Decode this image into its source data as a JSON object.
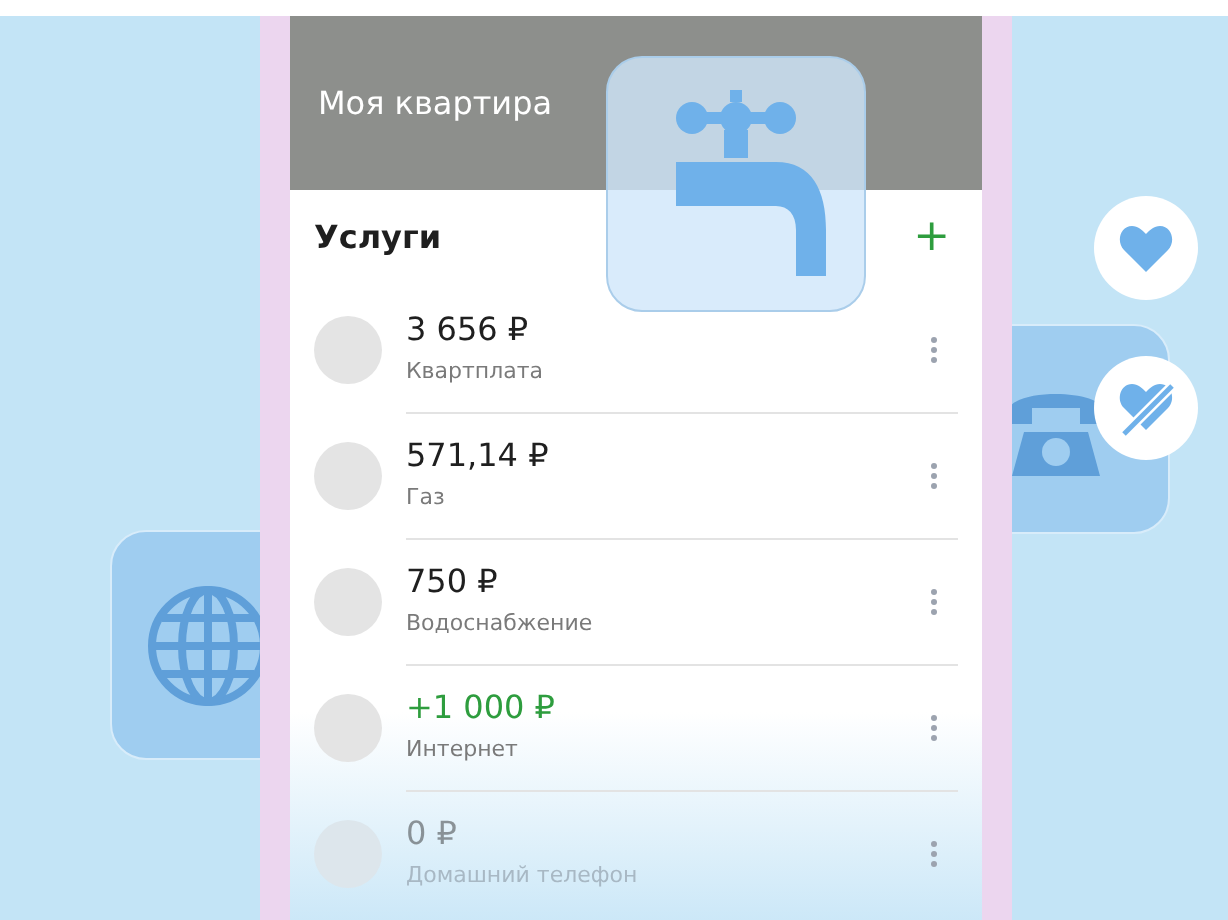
{
  "header": {
    "title": "Моя квартира"
  },
  "services": {
    "title": "Услуги",
    "add_label": "+",
    "items": [
      {
        "amount": "3 656 ₽",
        "name": "Квартплата",
        "kind": "charge",
        "dimmed": false
      },
      {
        "amount": "571,14 ₽",
        "name": "Газ",
        "kind": "charge",
        "dimmed": false
      },
      {
        "amount": "750 ₽",
        "name": "Водоснабжение",
        "kind": "charge",
        "dimmed": false
      },
      {
        "amount": "+1 000 ₽",
        "name": "Интернет",
        "kind": "credit",
        "dimmed": false
      },
      {
        "amount": "0 ₽",
        "name": "Домашний телефон",
        "kind": "charge",
        "dimmed": true
      }
    ]
  }
}
